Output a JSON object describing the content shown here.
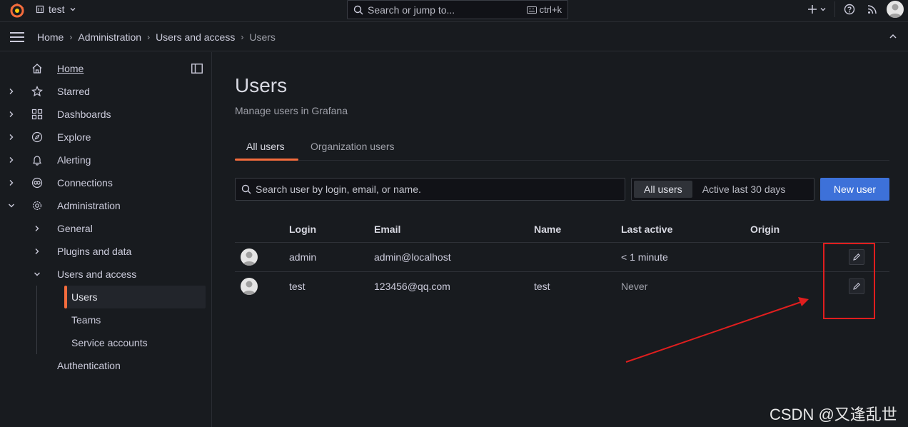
{
  "topbar": {
    "org_name": "test",
    "search_placeholder": "Search or jump to...",
    "search_shortcut": "ctrl+k"
  },
  "breadcrumb": [
    "Home",
    "Administration",
    "Users and access",
    "Users"
  ],
  "sidebar": {
    "items": [
      {
        "label": "Home",
        "icon": "home-icon"
      },
      {
        "label": "Starred",
        "icon": "star-icon"
      },
      {
        "label": "Dashboards",
        "icon": "apps-icon"
      },
      {
        "label": "Explore",
        "icon": "compass-icon"
      },
      {
        "label": "Alerting",
        "icon": "bell-icon"
      },
      {
        "label": "Connections",
        "icon": "connections-icon"
      },
      {
        "label": "Administration",
        "icon": "cog-icon"
      }
    ],
    "admin_children": [
      "General",
      "Plugins and data",
      "Users and access"
    ],
    "users_access_children": [
      "Users",
      "Teams",
      "Service accounts"
    ],
    "authentication": "Authentication"
  },
  "page": {
    "title": "Users",
    "subtitle": "Manage users in Grafana",
    "tabs": [
      "All users",
      "Organization users"
    ]
  },
  "toolbar": {
    "search_placeholder": "Search user by login, email, or name.",
    "filters": [
      "All users",
      "Active last 30 days"
    ],
    "new_user_label": "New user"
  },
  "table": {
    "columns": [
      "Login",
      "Email",
      "Name",
      "Last active",
      "Origin"
    ],
    "rows": [
      {
        "login": "admin",
        "email": "admin@localhost",
        "name": "",
        "last_active": "< 1 minute",
        "origin": ""
      },
      {
        "login": "test",
        "email": "123456@qq.com",
        "name": "test",
        "last_active": "Never",
        "origin": ""
      }
    ]
  },
  "colors": {
    "accent": "#f46c3d",
    "primary_button": "#3d71d9",
    "annotation": "#e01e1e"
  },
  "watermark": "CSDN @又逢乱世"
}
